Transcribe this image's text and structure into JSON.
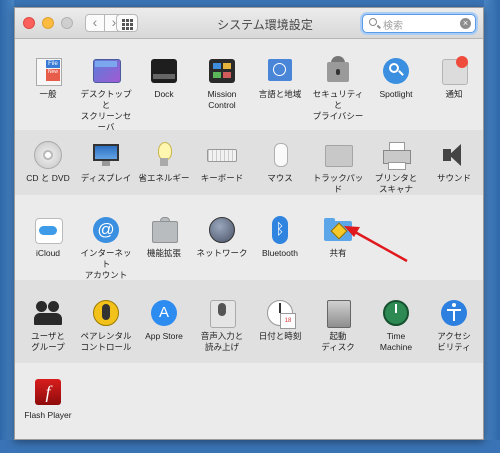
{
  "window": {
    "title": "システム環境設定"
  },
  "toolbar": {
    "back": "‹",
    "forward": "›"
  },
  "search": {
    "placeholder": "検索",
    "clear": "×"
  },
  "sections": {
    "personal": [
      {
        "id": "general",
        "label": "一般"
      },
      {
        "id": "desktop",
        "label": "デスクトップと\nスクリーンセーバ"
      },
      {
        "id": "dock",
        "label": "Dock"
      },
      {
        "id": "mission",
        "label": "Mission\nControl"
      },
      {
        "id": "language",
        "label": "言語と地域"
      },
      {
        "id": "security",
        "label": "セキュリティと\nプライバシー"
      },
      {
        "id": "spotlight",
        "label": "Spotlight"
      },
      {
        "id": "notifications",
        "label": "通知"
      }
    ],
    "hardware": [
      {
        "id": "cddvd",
        "label": "CD と DVD"
      },
      {
        "id": "displays",
        "label": "ディスプレイ"
      },
      {
        "id": "energy",
        "label": "省エネルギー"
      },
      {
        "id": "keyboard",
        "label": "キーボード"
      },
      {
        "id": "mouse",
        "label": "マウス"
      },
      {
        "id": "trackpad",
        "label": "トラックパッド"
      },
      {
        "id": "printers",
        "label": "プリンタと\nスキャナ"
      },
      {
        "id": "sound",
        "label": "サウンド"
      }
    ],
    "internet": [
      {
        "id": "icloud",
        "label": "iCloud"
      },
      {
        "id": "internet_accounts",
        "label": "インターネット\nアカウント"
      },
      {
        "id": "extensions",
        "label": "機能拡張"
      },
      {
        "id": "network",
        "label": "ネットワーク"
      },
      {
        "id": "bluetooth",
        "label": "Bluetooth"
      },
      {
        "id": "sharing",
        "label": "共有"
      }
    ],
    "system": [
      {
        "id": "users",
        "label": "ユーザと\nグループ"
      },
      {
        "id": "parental",
        "label": "ペアレンタル\nコントロール"
      },
      {
        "id": "appstore",
        "label": "App Store"
      },
      {
        "id": "dictation",
        "label": "音声入力と\n読み上げ"
      },
      {
        "id": "datetime",
        "label": "日付と時刻"
      },
      {
        "id": "startup",
        "label": "起動\nディスク"
      },
      {
        "id": "timemachine",
        "label": "Time\nMachine"
      },
      {
        "id": "accessibility",
        "label": "アクセシ\nビリティ"
      }
    ],
    "other": [
      {
        "id": "flash",
        "label": "Flash Player"
      }
    ]
  },
  "icon_text": {
    "general_file": "File",
    "general_new": "New",
    "internet_at": "@",
    "bluetooth": "ᛒ",
    "appstore": "A",
    "flash": "f",
    "date_num": "18"
  },
  "annotation": {
    "color": "#e0191e",
    "target": "sharing"
  }
}
